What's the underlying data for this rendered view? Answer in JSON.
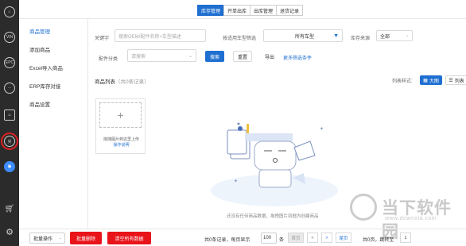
{
  "rail": {
    "icons": [
      "home-icon",
      "vin-icon",
      "epc-icon",
      "chat-icon",
      "contact-card-icon",
      "shop-icon",
      "product-icon",
      "cart-icon",
      "settings-icon"
    ],
    "labels": [
      "",
      "VIN",
      "EPC",
      "···",
      "",
      "买",
      "",
      "",
      ""
    ]
  },
  "top_tabs": [
    "库存管理",
    "开单出库",
    "出库管理",
    "退货记录"
  ],
  "subnav": {
    "items": [
      "商品管理",
      "添加商品",
      "Excel导入商品",
      "ERP库存对接",
      "商品设置"
    ]
  },
  "filters": {
    "keyword_label": "关键字",
    "keyword_placeholder": "搜索OEM/配件名称+车型描述",
    "car_filter_label": "按适用车型筛选",
    "car_filter_value": "所有车型",
    "stock_source_label": "库存来源",
    "stock_source_value": "全部",
    "category_label": "配件分类",
    "category_placeholder": "请搜索",
    "search_btn": "搜索",
    "reset_btn": "重置",
    "export_btn": "导出",
    "more_filters": "更多筛选条件"
  },
  "list": {
    "title": "商品列表",
    "count": "（共0条记录）",
    "view_label": "列表样式:",
    "view_grid": "大图",
    "view_list": "列表"
  },
  "upload_card": {
    "plus": "+",
    "hint": "拖拽图片到这里上传",
    "link": "操作说明"
  },
  "empty": {
    "hint": "还没有任何商品数据，拖拽图片到框内创建商品"
  },
  "bottom": {
    "batch_select": "批量操作",
    "batch_delete": "批量删除",
    "clear_all": "清空所有数据",
    "records": "共0条记录，每页显示",
    "page_size": "100",
    "unit": "条",
    "first": "首页",
    "prev": "<",
    "next": ">",
    "last": "尾页",
    "pages_total": "共0页，跳转至",
    "jump_value": "1"
  },
  "watermark": {
    "text": "当下软件园",
    "url": "www.downxia.com"
  },
  "colors": {
    "primary": "#1f6fd1",
    "danger": "#e8141a",
    "rail": "#2b2b2b"
  }
}
